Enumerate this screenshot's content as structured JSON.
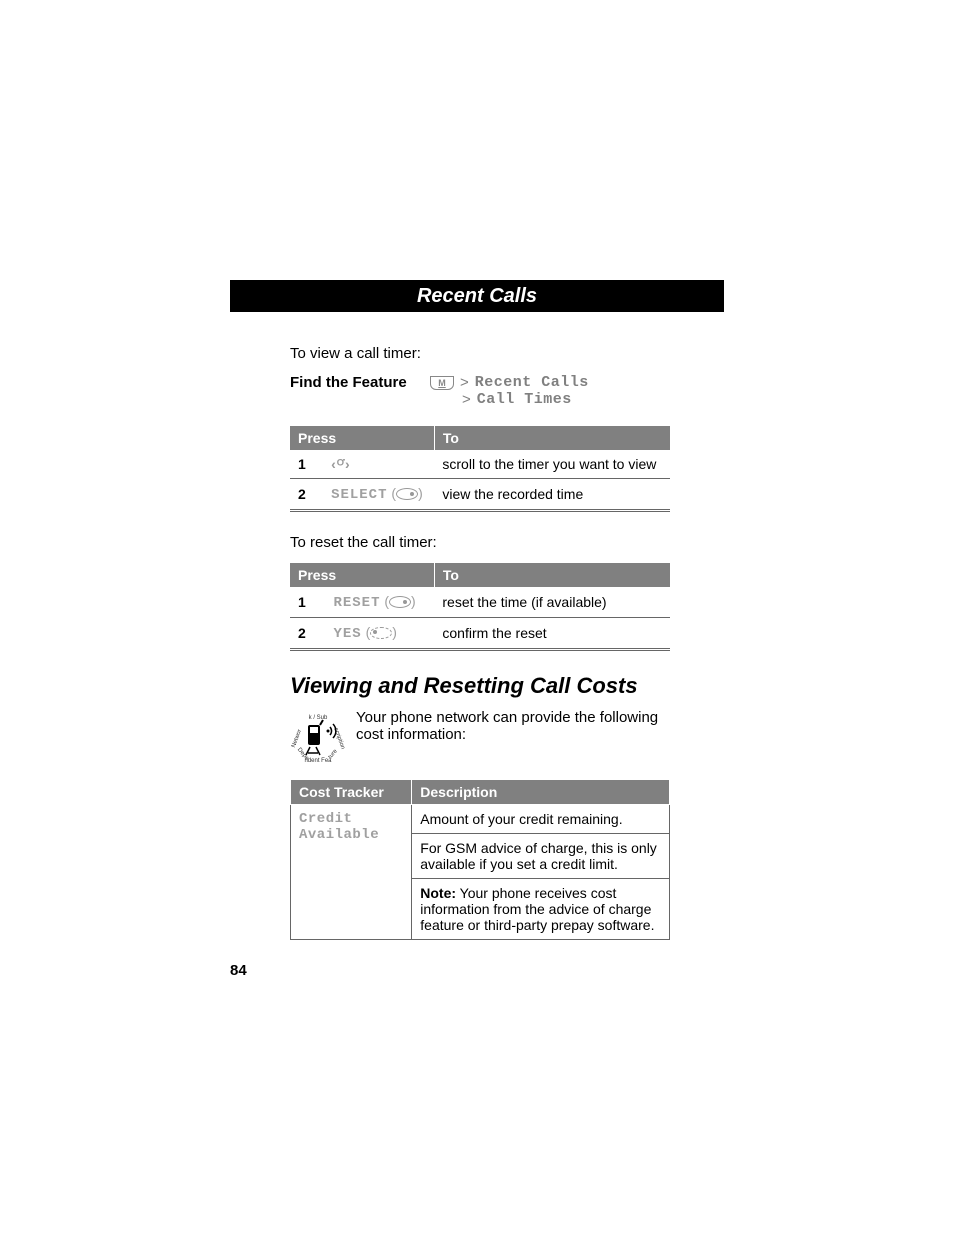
{
  "header": {
    "title": "Recent Calls"
  },
  "intro1": "To view a call timer:",
  "feature": {
    "label": "Find the Feature",
    "line1_menu": "Recent Calls",
    "line2_menu": "Call Times",
    "gt": ">"
  },
  "table1": {
    "headers": {
      "press": "Press",
      "to": "To"
    },
    "rows": [
      {
        "num": "1",
        "press_type": "navkey",
        "press": "",
        "to": "scroll to the timer you want to view"
      },
      {
        "num": "2",
        "press_type": "softkey",
        "press": "SELECT",
        "oval": "right",
        "to": "view the recorded time"
      }
    ]
  },
  "intro2": "To reset the call timer:",
  "table2": {
    "headers": {
      "press": "Press",
      "to": "To"
    },
    "rows": [
      {
        "num": "1",
        "press_type": "softkey",
        "press": "RESET",
        "oval": "right",
        "to": "reset the time (if available)"
      },
      {
        "num": "2",
        "press_type": "softkey",
        "press": "YES",
        "oval": "left",
        "to": "confirm the reset"
      }
    ]
  },
  "section_title": "Viewing and Resetting Call Costs",
  "network_text": "Your phone network can provide the following cost information:",
  "cost_table": {
    "headers": {
      "tracker": "Cost Tracker",
      "desc": "Description"
    },
    "row": {
      "tracker_line1": "Credit",
      "tracker_line2": "Available",
      "desc1": "Amount of your credit remaining.",
      "desc2": "For GSM advice of charge, this is only available if you set a credit limit.",
      "note_label": "Note:",
      "desc3": " Your phone receives cost information from the advice of charge feature or third-party prepay software."
    }
  },
  "page_number": "84"
}
